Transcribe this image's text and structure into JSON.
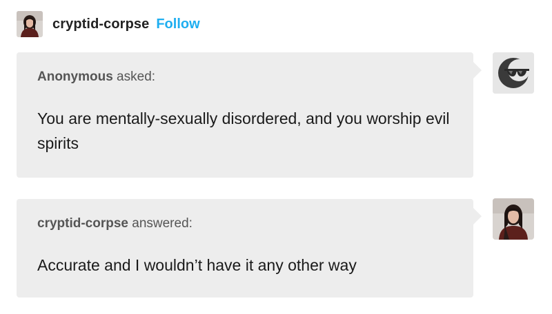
{
  "header": {
    "username": "cryptid-corpse",
    "follow_label": "Follow",
    "avatar_icon": "user-photo-icon"
  },
  "ask": {
    "asker_name": "Anonymous",
    "verb": " asked:",
    "question": "You are mentally-sexually disordered, and you worship evil spirits",
    "avatar_icon": "anonymous-sunglasses-icon"
  },
  "answer": {
    "answerer_name": "cryptid-corpse",
    "verb": " answered:",
    "text": "Accurate and I wouldn’t have it any other way",
    "avatar_icon": "user-photo-icon"
  },
  "colors": {
    "follow": "#1eaef0",
    "bubble_bg": "#ededed",
    "text": "#1a1a1a",
    "byline": "#555555"
  }
}
